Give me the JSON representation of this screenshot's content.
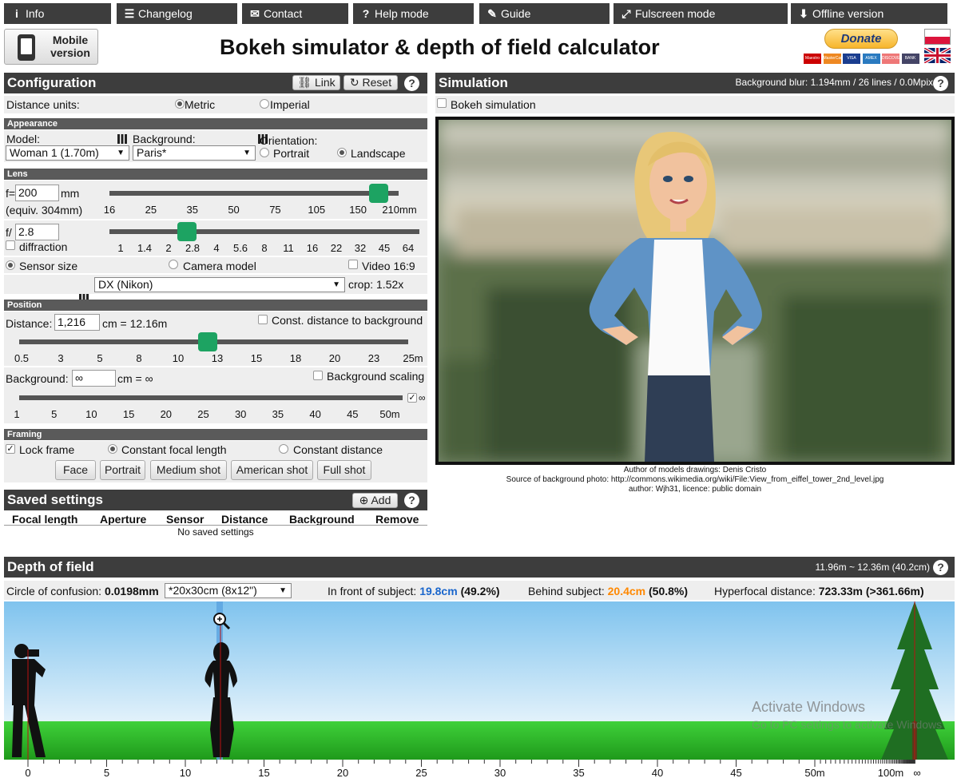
{
  "nav": [
    {
      "icon": "i",
      "label": "Info"
    },
    {
      "icon": "☰",
      "label": "Changelog"
    },
    {
      "icon": "✉",
      "label": "Contact"
    },
    {
      "icon": "?",
      "label": "Help mode"
    },
    {
      "icon": "✎",
      "label": "Guide"
    },
    {
      "icon": "⤢",
      "label": "Fulscreen mode"
    },
    {
      "icon": "⬇",
      "label": "Offline version"
    }
  ],
  "mobile": {
    "line1": "Mobile",
    "line2": "version"
  },
  "title": "Bokeh simulator & depth of field calculator",
  "donate": "Donate",
  "payment_labels": [
    "Maestro",
    "MasterCard",
    "VISA",
    "AMEX",
    "DISCOVER",
    "BANK"
  ],
  "config": {
    "title": "Configuration",
    "link": "Link",
    "reset": "Reset",
    "units_label": "Distance units:",
    "metric": "Metric",
    "imperial": "Imperial"
  },
  "appearance": {
    "title": "Appearance",
    "model_label": "Model:",
    "model_value": "Woman 1 (1.70m)",
    "bg_label": "Background:",
    "bg_value": "Paris*",
    "orient_label": "Orientation:",
    "portrait": "Portrait",
    "landscape": "Landscape"
  },
  "lens": {
    "title": "Lens",
    "f_prefix": "f=",
    "f_value": "200",
    "f_unit": "mm",
    "equiv": "(equiv. 304mm)",
    "focal_ticks": [
      "16",
      "25",
      "35",
      "50",
      "75",
      "105",
      "150",
      "210mm"
    ],
    "focal_pos": 0.93,
    "ap_prefix": "f/",
    "ap_value": "2.8",
    "diffraction": "diffraction",
    "ap_ticks": [
      "1",
      "1.4",
      "2",
      "2.8",
      "4",
      "5.6",
      "8",
      "11",
      "16",
      "22",
      "32",
      "45",
      "64"
    ],
    "ap_pos": 0.25,
    "sensor_size": "Sensor size",
    "camera_model": "Camera model",
    "video": "Video 16:9",
    "sensor_value": "DX (Nikon)",
    "crop": "crop: 1.52x"
  },
  "position": {
    "title": "Position",
    "dist_label": "Distance:",
    "dist_value": "1,216",
    "dist_suffix": "cm = 12.16m",
    "const_label": "Const. distance to background",
    "dist_ticks": [
      "0.5",
      "3",
      "5",
      "8",
      "10",
      "13",
      "15",
      "18",
      "20",
      "23",
      "25m"
    ],
    "dist_pos": 0.485,
    "bg_label": "Background:",
    "bg_value": "∞",
    "bg_suffix": "cm = ∞",
    "bg_scaling": "Background scaling",
    "bg_ticks": [
      "1",
      "5",
      "10",
      "15",
      "20",
      "25",
      "30",
      "35",
      "40",
      "45",
      "50m"
    ],
    "inf_symbol": "∞"
  },
  "framing": {
    "title": "Framing",
    "lock": "Lock frame",
    "const_focal": "Constant focal length",
    "const_dist": "Constant distance",
    "buttons": [
      "Face",
      "Portrait",
      "Medium shot",
      "American shot",
      "Full shot"
    ]
  },
  "saved": {
    "title": "Saved settings",
    "add": "Add",
    "cols": [
      "Focal length",
      "Aperture",
      "Sensor",
      "Distance",
      "Background",
      "Remove"
    ],
    "empty": "No saved settings"
  },
  "sim": {
    "title": "Simulation",
    "blur": "Background blur: 1.194mm / 26 lines / 0.0Mpix",
    "bokeh": "Bokeh simulation",
    "credit1": "Author of models drawings: Denis Cristo",
    "credit2": "Source of background photo: http://commons.wikimedia.org/wiki/File:View_from_eiffel_tower_2nd_level.jpg",
    "credit3": "author: Wjh31, licence: public domain"
  },
  "dof": {
    "title": "Depth of field",
    "range": "11.96m ~ 12.36m (40.2cm)",
    "coc_label": "Circle of confusion:",
    "coc_value": "0.0198mm",
    "coc_select": "*20x30cm (8x12\")",
    "front_label": "In front of subject:",
    "front_value": "19.8cm",
    "front_pct": "(49.2%)",
    "behind_label": "Behind subject:",
    "behind_value": "20.4cm",
    "behind_pct": "(50.8%)",
    "hyper_label": "Hyperfocal distance:",
    "hyper_value": "723.33m (>361.66m)",
    "scale": [
      "0",
      "5",
      "10",
      "15",
      "20",
      "25",
      "30",
      "35",
      "40",
      "45",
      "50m",
      "100m",
      "∞"
    ],
    "front_color": "#1a66cc",
    "behind_color": "#ff8800"
  },
  "watermark": {
    "line1": "Activate Windows",
    "line2": "Go to PC settings to activate Windows"
  }
}
